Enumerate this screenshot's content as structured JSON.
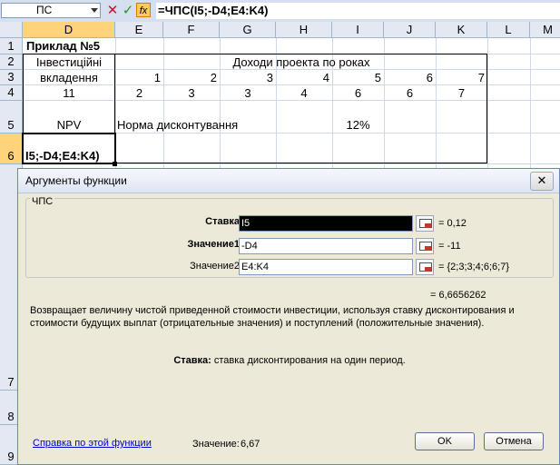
{
  "formula_bar": {
    "name_box": "ПС",
    "cancel_symbol": "✕",
    "enter_symbol": "✓",
    "fx_symbol": "fx",
    "formula": "=ЧПС(I5;-D4;E4:K4)"
  },
  "columns": [
    "D",
    "E",
    "F",
    "G",
    "H",
    "I",
    "J",
    "K",
    "L",
    "M"
  ],
  "rows": [
    "1",
    "2",
    "3",
    "4",
    "5",
    "6",
    "7",
    "8",
    "9"
  ],
  "cells": {
    "d1": "Приклад №5",
    "d2": "Інвестиційні",
    "d3": "вкладення",
    "row2_header": "Доходи проекта по роках",
    "years": [
      "1",
      "2",
      "3",
      "4",
      "5",
      "6",
      "7"
    ],
    "d4": "11",
    "income": [
      "2",
      "3",
      "3",
      "4",
      "6",
      "6",
      "7"
    ],
    "d5": "NPV",
    "e5": "Норма дисконтування",
    "i5": "12%",
    "d6": "I5;-D4;E4:K4)"
  },
  "dialog": {
    "title": "Аргументы функции",
    "close_symbol": "✕",
    "function_name": "ЧПС",
    "args": [
      {
        "label": "Ставка",
        "value": "I5",
        "result": "= 0,12"
      },
      {
        "label": "Значение1",
        "value": "-D4",
        "result": "= -11"
      },
      {
        "label": "Значение2",
        "value": "E4:K4",
        "result": "= {2;3;3;4;6;6;7}"
      }
    ],
    "total_result": "= 6,6656262",
    "description": "Возвращает величину чистой приведенной стоимости инвестиции, используя ставку дисконтирования и стоимости будущих выплат (отрицательные значения) и поступлений (положительные значения).",
    "arg_help_label": "Ставка:",
    "arg_help_text": "ставка дисконтирования на один период.",
    "help_link": "Справка по этой функции",
    "value_label": "Значение:",
    "value": "6,67",
    "ok_label": "OK",
    "cancel_label": "Отмена"
  }
}
